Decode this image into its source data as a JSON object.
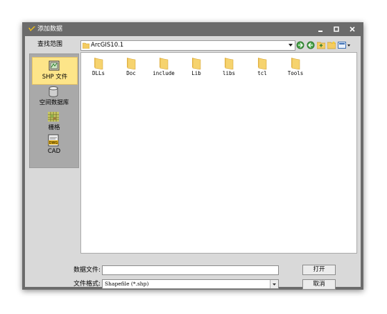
{
  "window": {
    "title": "添加数据"
  },
  "sidebar": {
    "heading": "查找范围",
    "items": [
      {
        "label": "SHP 文件",
        "icon": "shp-file-icon",
        "selected": true
      },
      {
        "label": "空间数据库",
        "icon": "database-icon",
        "selected": false
      },
      {
        "label": "栅格",
        "icon": "raster-grid-icon",
        "selected": false
      },
      {
        "label": "CAD",
        "icon": "dwg-cad-icon",
        "selected": false
      }
    ]
  },
  "location": {
    "path": "ArcGIS10.1"
  },
  "toolbar": {
    "icons": [
      "globe-forward-icon",
      "globe-back-icon",
      "up-folder-icon",
      "new-folder-icon",
      "view-menu-icon"
    ]
  },
  "files": [
    {
      "name": "DLLs"
    },
    {
      "name": "Doc"
    },
    {
      "name": "include"
    },
    {
      "name": "Lib"
    },
    {
      "name": "libs"
    },
    {
      "name": "tcl"
    },
    {
      "name": "Tools"
    }
  ],
  "form": {
    "data_file_label": "数据文件:",
    "data_file_value": "",
    "format_label": "文件格式:",
    "format_value": "Shapefile (*.shp)",
    "open_label": "打开",
    "cancel_label": "取消"
  },
  "colors": {
    "folder": "#f4cc62",
    "selected_bg": "#fde589",
    "title_bar": "#6b6b6b"
  }
}
